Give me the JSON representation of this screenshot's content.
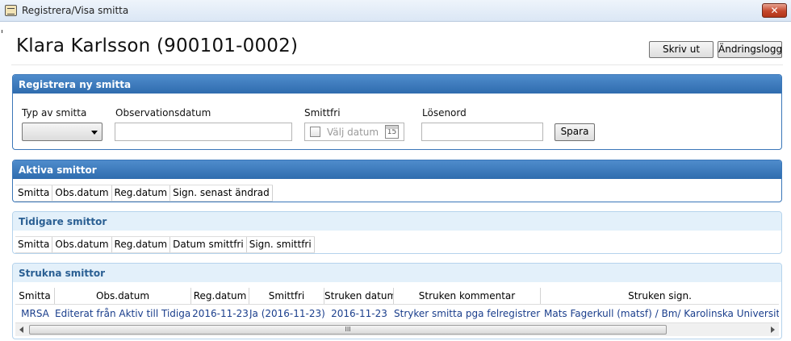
{
  "window": {
    "title": "Registrera/Visa smitta",
    "close_glyph": "✕"
  },
  "header": {
    "patient": "Klara Karlsson (900101-0002)",
    "print_label": "Skriv ut",
    "log_label": "Ändringslogg"
  },
  "register": {
    "title": "Registrera ny smitta",
    "type_label": "Typ av smitta",
    "obs_label": "Observationsdatum",
    "free_label": "Smittfri",
    "free_placeholder": "Välj datum",
    "calendar_day": "15",
    "password_label": "Lösenord",
    "save_label": "Spara"
  },
  "active": {
    "title": "Aktiva smittor",
    "columns": [
      "Smitta",
      "Obs.datum",
      "Reg.datum",
      "Sign. senast ändrad"
    ]
  },
  "previous": {
    "title": "Tidigare smittor",
    "columns": [
      "Smitta",
      "Obs.datum",
      "Reg.datum",
      "Datum smittfri",
      "Sign. smittfri"
    ]
  },
  "struck": {
    "title": "Strukna smittor",
    "columns": [
      "Smitta",
      "Obs.datum",
      "Reg.datum",
      "Smittfri",
      "Struken datum",
      "Struken kommentar",
      "Struken sign."
    ],
    "rows": [
      [
        "MRSA",
        "Editerat från Aktiv till Tidigare",
        "2016-11-23",
        "Ja (2016-11-23)",
        "2016-11-23",
        "Stryker smitta pga felregistrering",
        "Mats Fagerkull (matsf) / Bm/ Karolinska Universitets Sjukhus"
      ]
    ],
    "scroll_grip": "III"
  }
}
